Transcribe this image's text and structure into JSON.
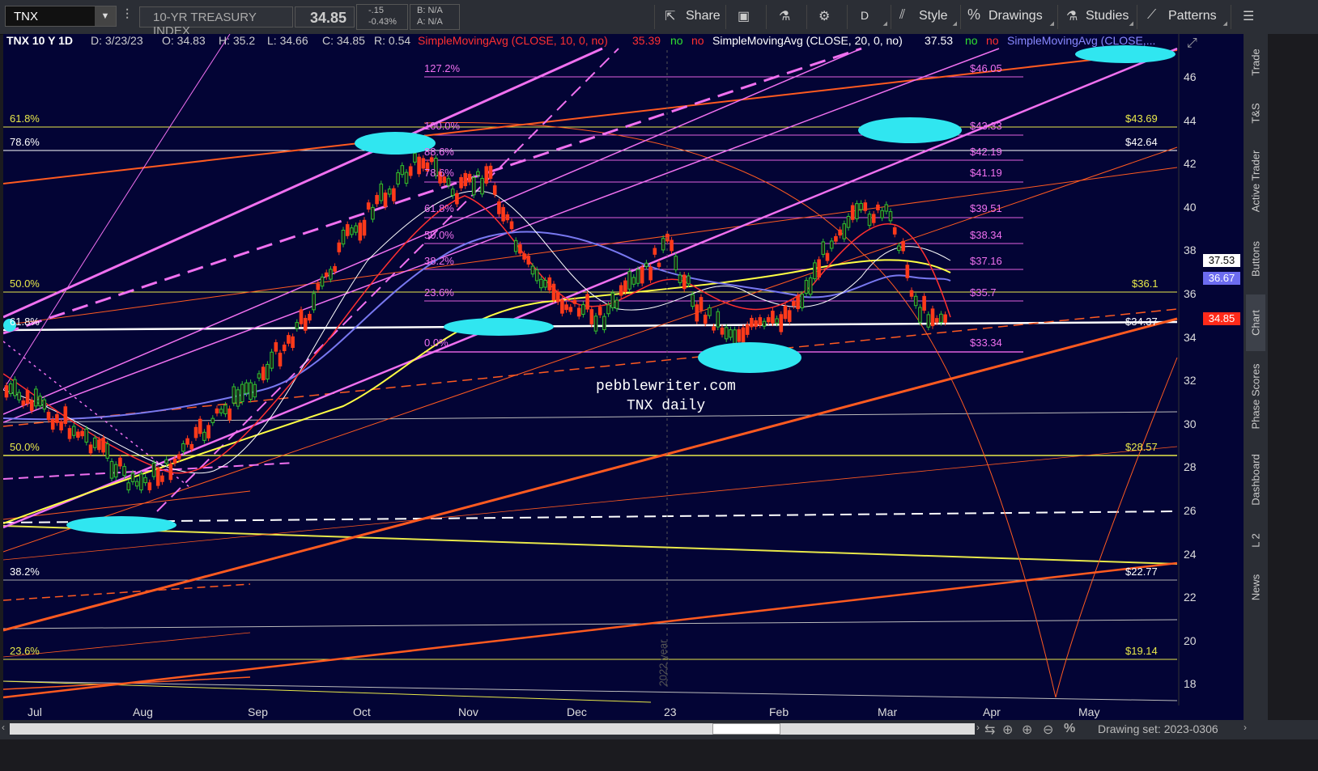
{
  "toolbar": {
    "symbol": "TNX",
    "description": "10-YR TREASURY INDEX",
    "last": "34.85",
    "change": "-.15",
    "change_pct": "-0.43%",
    "bid": "B: N/A",
    "ask": "A: N/A",
    "share": "Share",
    "period": "D",
    "style": "Style",
    "drawings": "Drawings",
    "studies": "Studies",
    "patterns": "Patterns"
  },
  "header": {
    "title": "TNX 10 Y 1D",
    "date": "D: 3/23/23",
    "open": "O: 34.83",
    "high": "H: 35.2",
    "low": "L: 34.66",
    "close": "C: 34.85",
    "range": "R: 0.54",
    "sma10": "SimpleMovingAvg (CLOSE, 10, 0, no)",
    "sma10_val": "35.39",
    "sma20": "SimpleMovingAvg (CLOSE, 20, 0, no)",
    "sma20_val": "37.53",
    "sma_next": "SimpleMovingAvg (CLOSE,...",
    "no": "no"
  },
  "chart_data": {
    "type": "candlestick",
    "xlabels": [
      "Jul",
      "Aug",
      "Sep",
      "Oct",
      "Nov",
      "Dec",
      "23",
      "Feb",
      "Mar",
      "Apr",
      "May"
    ],
    "ylabels": [
      "46",
      "44",
      "42",
      "40",
      "38",
      "36",
      "34",
      "32",
      "30",
      "28",
      "26",
      "24",
      "22",
      "20",
      "18"
    ],
    "price_tags": [
      {
        "text": "37.53",
        "color": "#ffffff",
        "text_color": "#000000"
      },
      {
        "text": "36.67",
        "color": "#6c6cf0",
        "text_color": "#ffffff"
      },
      {
        "text": "34.85",
        "color": "#ff2a1a",
        "text_color": "#ffffff"
      }
    ],
    "fib_labels_left": [
      "127.2%",
      "100.0%",
      "88.6%",
      "78.6%",
      "61.8%",
      "50.0%",
      "38.2%",
      "23.6%",
      "0.0%"
    ],
    "fib_values_right": [
      "$46.05",
      "$43.33",
      "$42.19",
      "$41.19",
      "$39.51",
      "$38.34",
      "$37.16",
      "$35.7",
      "$33.34"
    ],
    "yellow_levels": [
      "$43.69",
      "$36.1",
      "$28.57",
      "$22.77",
      "$19.14"
    ],
    "white_levels": [
      "$42.64",
      "$34.37"
    ],
    "outer_fib_labels": [
      "61.8%",
      "78.6%",
      "50.0%",
      "61.8%",
      "50.0%",
      "38.2%",
      "23.6%"
    ],
    "watermark": "pebblewriter.com",
    "watermark2": "TNX daily",
    "year_label": "2022 year"
  },
  "sidebar": [
    "Trade",
    "T&S",
    "Active Trader",
    "Buttons",
    "Chart",
    "Phase Scores",
    "Dashboard",
    "L 2",
    "News"
  ],
  "bottom": {
    "drawing_set": "Drawing set: 2023-0306"
  }
}
